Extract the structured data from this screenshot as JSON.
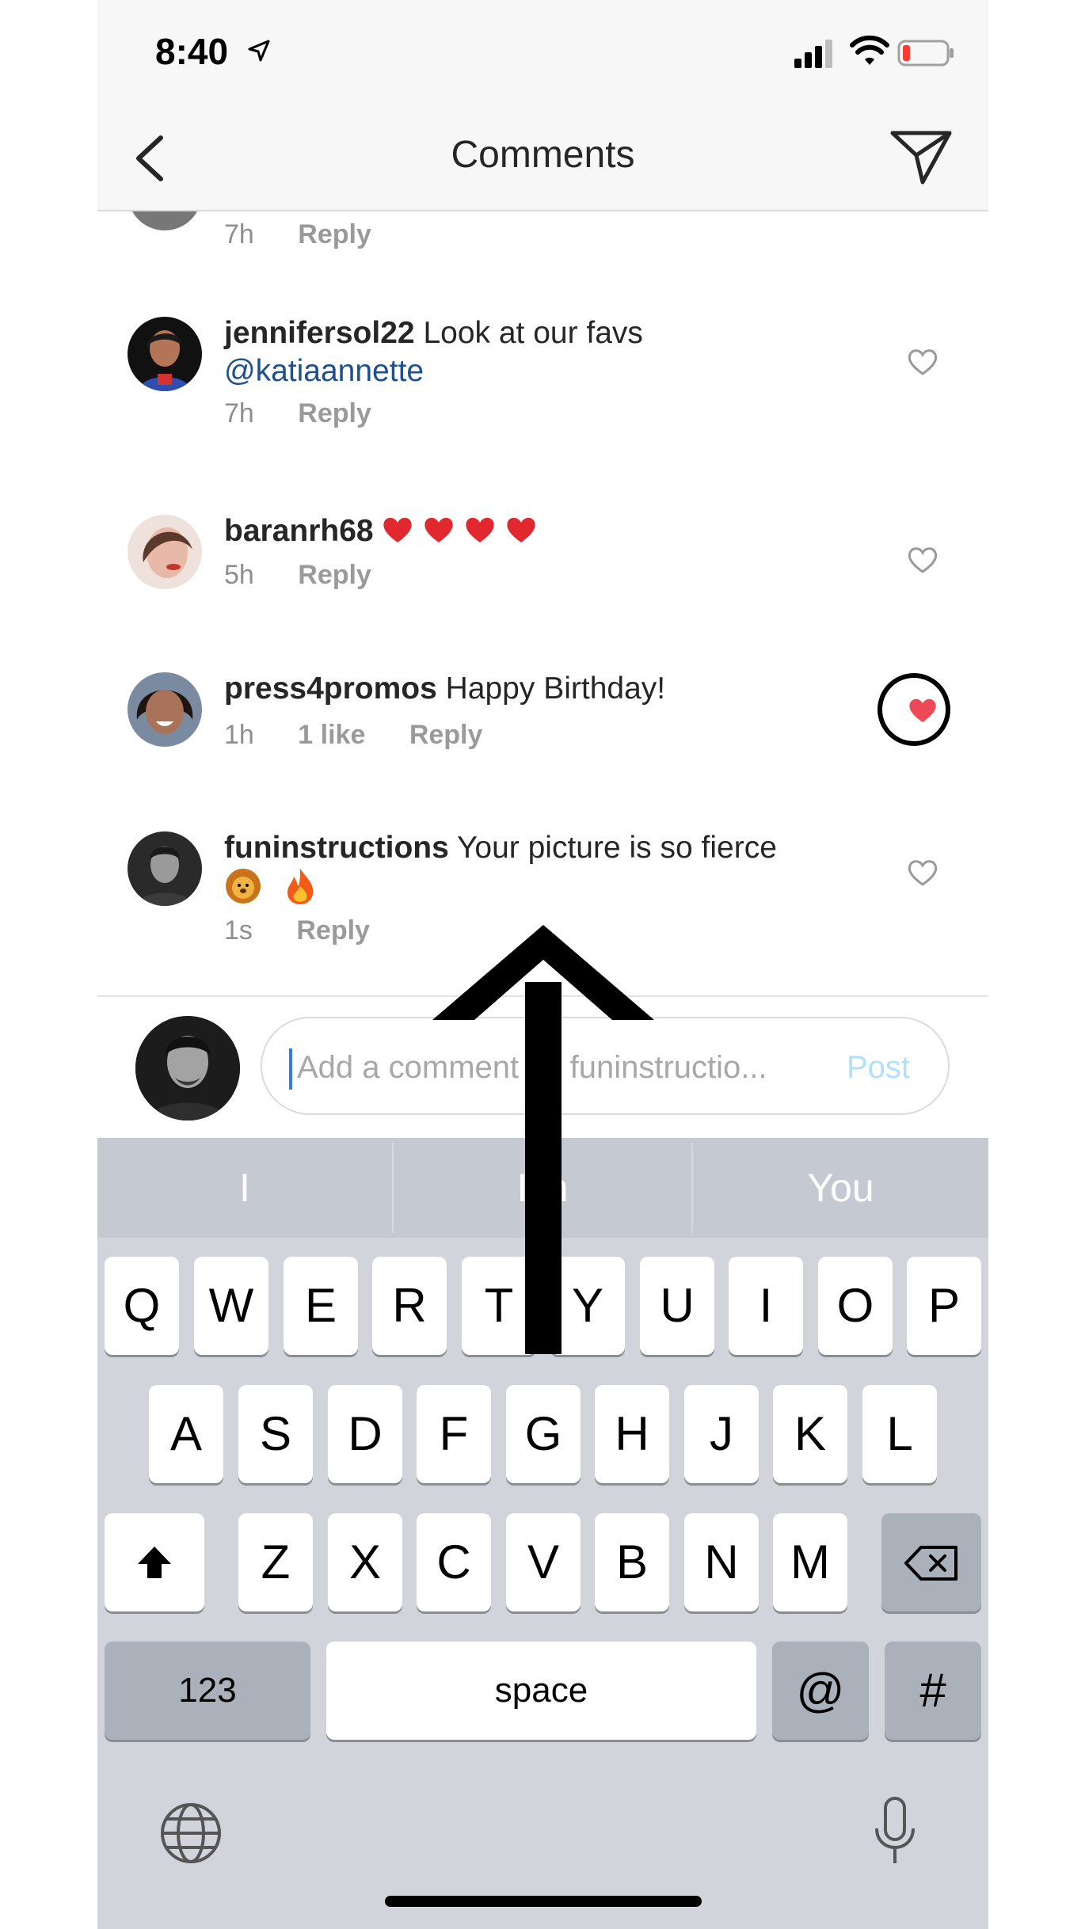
{
  "status": {
    "time": "8:40"
  },
  "nav": {
    "title": "Comments"
  },
  "comments": [
    {
      "time": "7h",
      "reply": "Reply"
    },
    {
      "username": "jennifersol22",
      "text": "Look at our favs",
      "mention": "@katiaannette",
      "time": "7h",
      "reply": "Reply"
    },
    {
      "username": "baranrh68",
      "text": "",
      "emoji": [
        "heart",
        "heart",
        "heart",
        "heart"
      ],
      "time": "5h",
      "reply": "Reply"
    },
    {
      "username": "press4promos",
      "text": "Happy Birthday!",
      "time": "1h",
      "likes": "1 like",
      "reply": "Reply",
      "liked": true
    },
    {
      "username": "funinstructions",
      "text": "Your picture is so fierce",
      "emoji": [
        "lion",
        "fire"
      ],
      "time": "1s",
      "reply": "Reply"
    }
  ],
  "input": {
    "placeholder": "Add a comment as funinstructio...",
    "post_label": "Post"
  },
  "keyboard": {
    "suggestions": [
      "I",
      "I'm",
      "You"
    ],
    "row1": [
      "Q",
      "W",
      "E",
      "R",
      "T",
      "Y",
      "U",
      "I",
      "O",
      "P"
    ],
    "row2": [
      "A",
      "S",
      "D",
      "F",
      "G",
      "H",
      "J",
      "K",
      "L"
    ],
    "row3": [
      "Z",
      "X",
      "C",
      "V",
      "B",
      "N",
      "M"
    ],
    "numbers_label": "123",
    "space_label": "space",
    "at_label": "@",
    "hash_label": "#"
  },
  "colors": {
    "accent_blue": "#3897f0",
    "like_red": "#ed4956",
    "mention_blue": "#1d4f91"
  }
}
